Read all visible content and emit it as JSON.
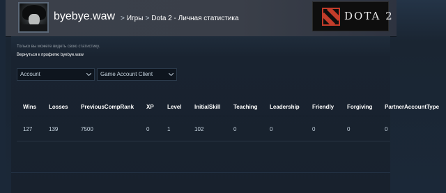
{
  "header": {
    "username": "byebye.waw",
    "breadcrumb": {
      "games": "Игры",
      "separator": ">",
      "page": "Dota 2 - Личная статистика"
    },
    "logo_text": "DOTA 2"
  },
  "main": {
    "notice": "Только вы можете видеть свою статистику.",
    "back_link": "Вернуться к профилю byebye.waw",
    "filters": {
      "account": "Account",
      "client": "Game Account Client"
    },
    "table": {
      "columns": [
        "Wins",
        "Losses",
        "PreviousCompRank",
        "XP",
        "Level",
        "InitialSkill",
        "Teaching",
        "Leadership",
        "Friendly",
        "Forgiving",
        "PartnerAccountType"
      ],
      "rows": [
        [
          "127",
          "139",
          "7500",
          "0",
          "1",
          "102",
          "0",
          "0",
          "0",
          "0",
          "0"
        ]
      ]
    }
  },
  "colors": {
    "background": "#1b2838",
    "header": "#3b404a",
    "text_primary": "#ffffff",
    "text_secondary": "#c7d5e0",
    "text_muted": "#8f98a0"
  },
  "icons": {
    "logo_emblem": "dota-emblem-icon",
    "dropdown": "chevron-down-icon"
  }
}
